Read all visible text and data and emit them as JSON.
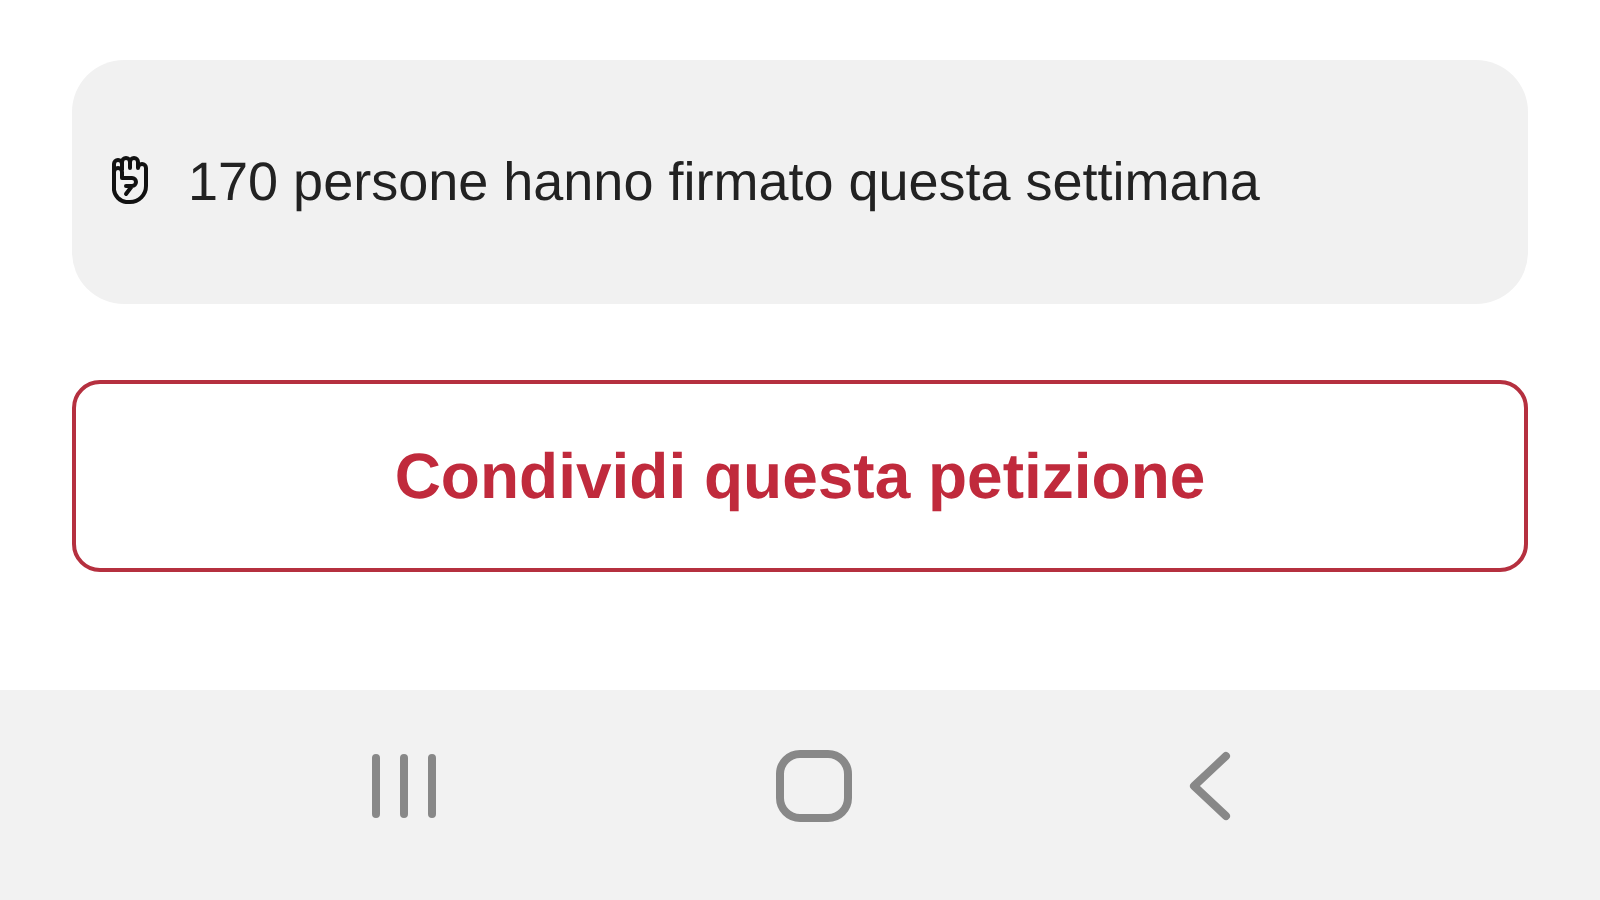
{
  "signatures_notice": {
    "text": "170 persone hanno firmato questa settimana"
  },
  "share_button": {
    "label": "Condividi questa petizione"
  }
}
